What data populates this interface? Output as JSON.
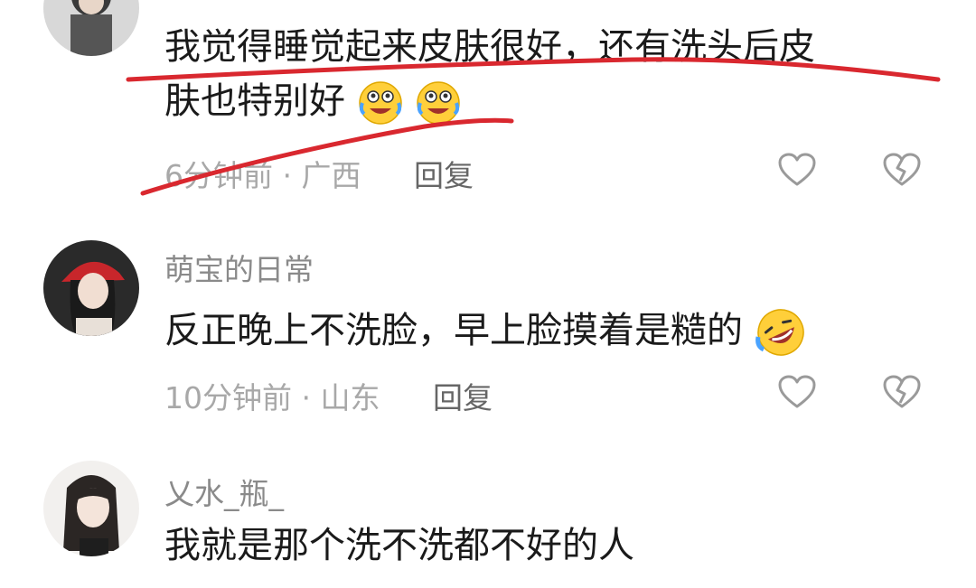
{
  "comments": [
    {
      "username": "",
      "text_line1": "我觉得睡觉起来皮肤很好，还有洗头后皮",
      "text_line2": "肤也特别好",
      "emoji_icons": [
        "crying-laughing-emoji-icon",
        "crying-laughing-emoji-icon"
      ],
      "time": "6分钟前",
      "location": "广西",
      "reply_label": "回复"
    },
    {
      "username": "萌宝的日常",
      "text": "反正晚上不洗脸，早上脸摸着是糙的",
      "emoji_icons": [
        "rolling-laughing-emoji-icon"
      ],
      "time": "10分钟前",
      "location": "山东",
      "reply_label": "回复"
    },
    {
      "username": "乂水_瓶_",
      "text": "我就是那个洗不洗都不好的人"
    }
  ],
  "separator": " · ",
  "colors": {
    "annotation_red": "#d9282f",
    "muted": "#a8a8a8",
    "text": "#1a1a1a"
  }
}
